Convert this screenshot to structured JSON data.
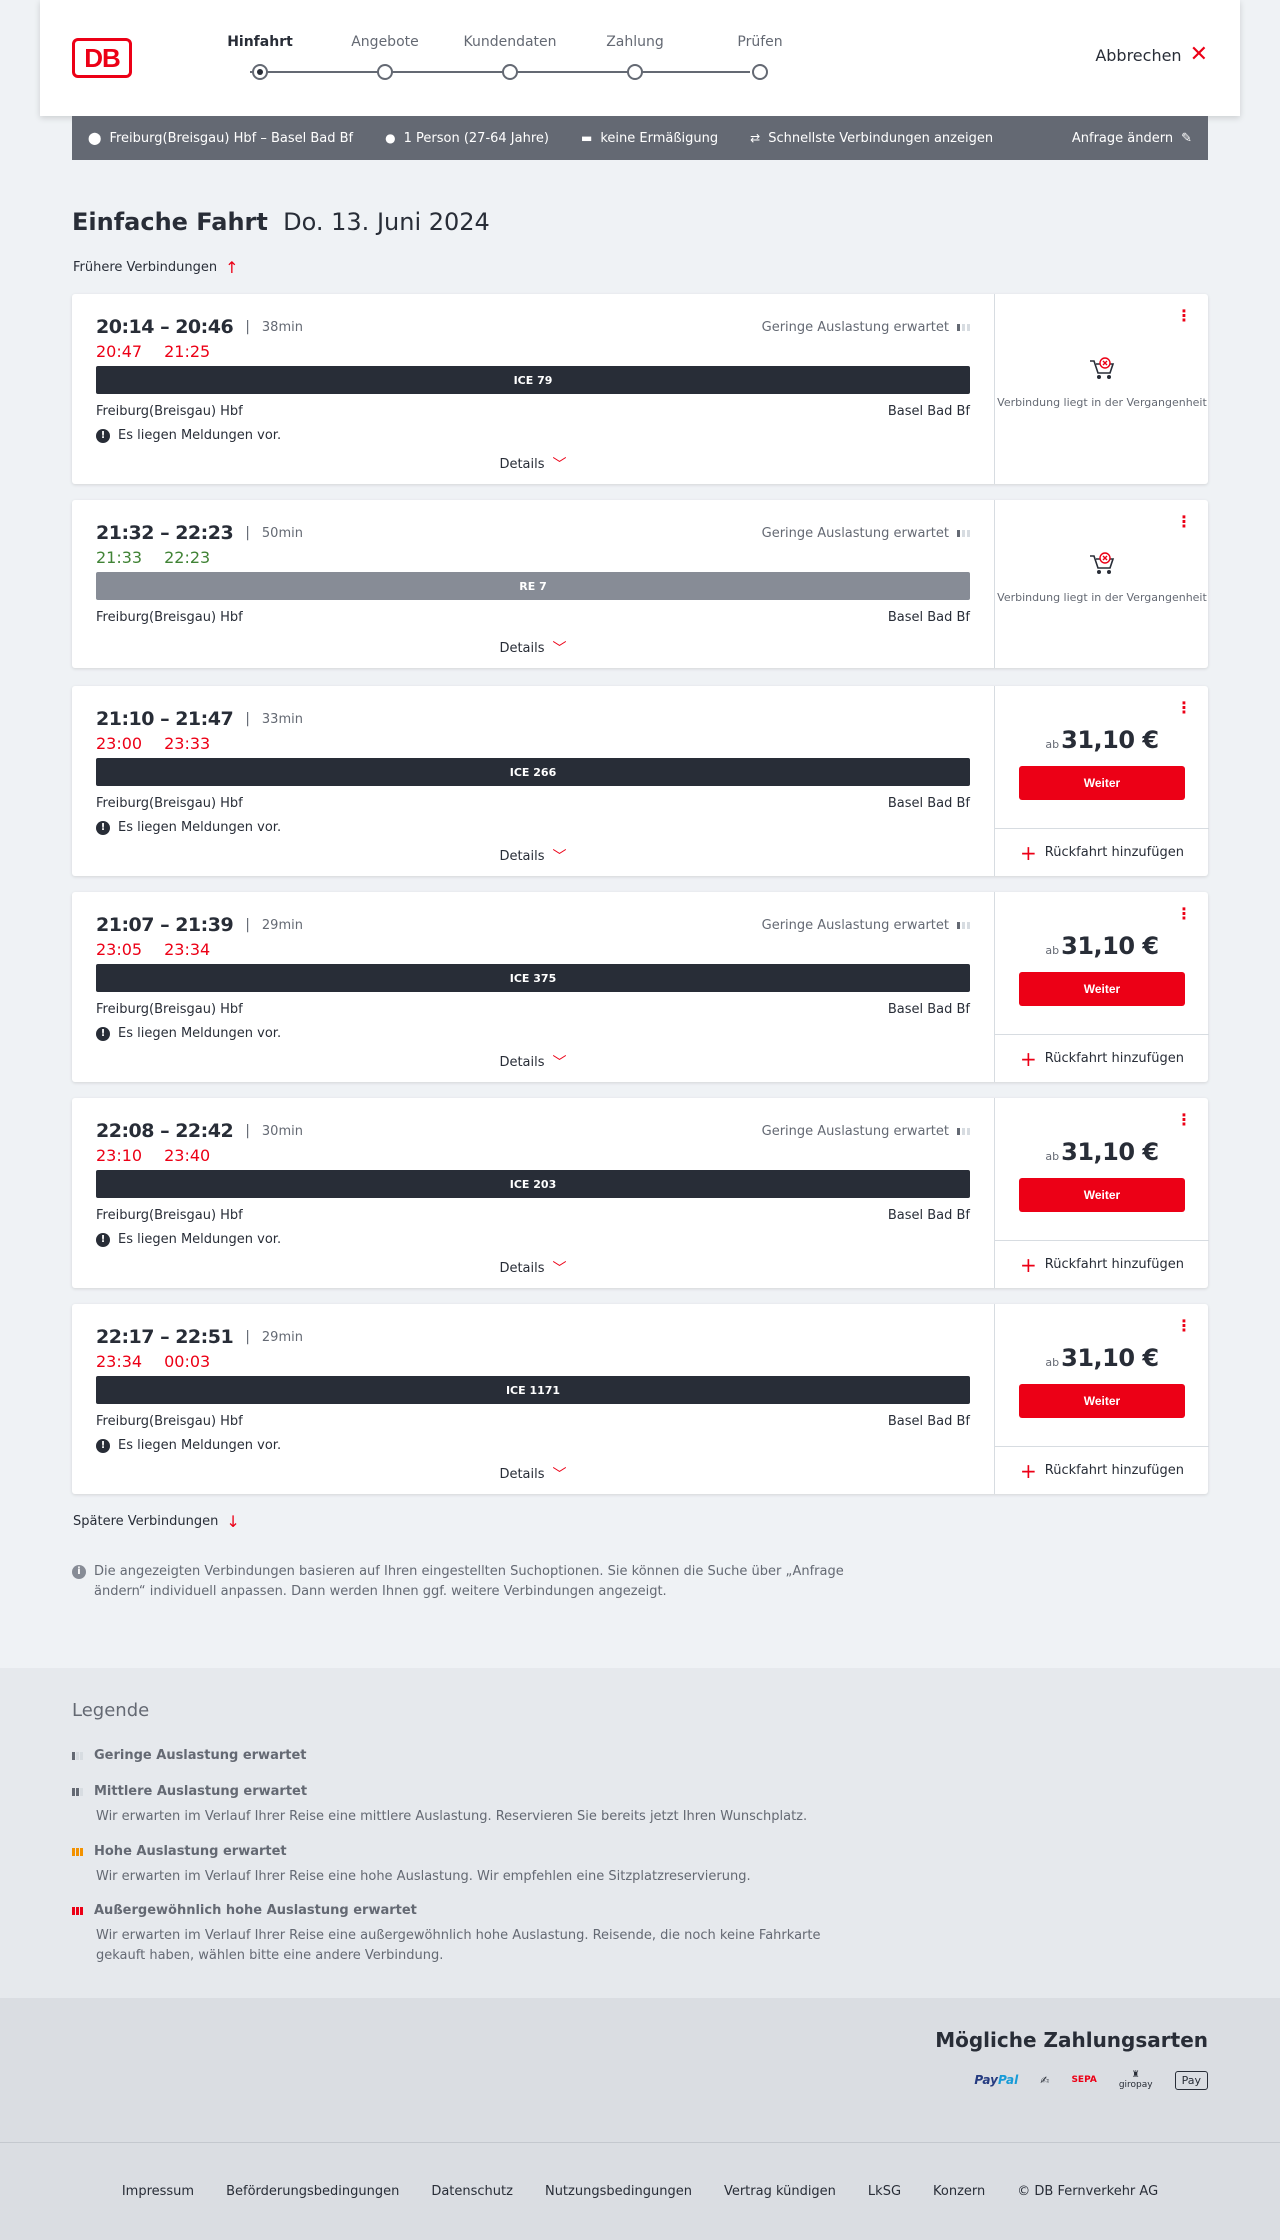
{
  "header": {
    "logo": "DB",
    "steps": [
      "Hinfahrt",
      "Angebote",
      "Kundendaten",
      "Zahlung",
      "Prüfen"
    ],
    "cancel_label": "Abbrechen"
  },
  "query": {
    "route": "Freiburg(Breisgau) Hbf – Basel Bad Bf",
    "persons": "1 Person (27-64 Jahre)",
    "discount": "keine Ermäßigung",
    "fastest": "Schnellste Verbindungen anzeigen",
    "edit_label": "Anfrage ändern"
  },
  "title": {
    "trip_type": "Einfache Fahrt",
    "date": "Do. 13. Juni 2024"
  },
  "earlier_label": "Frühere Verbindungen",
  "later_label": "Spätere Verbindungen",
  "common": {
    "details_label": "Details",
    "message_label": "Es liegen Meldungen vor.",
    "past_label": "Verbindung liegt in der Vergangenheit",
    "price_prefix": "ab",
    "weiter_label": "Weiter",
    "return_label": "Rückfahrt hinzufügen",
    "load_low": "Geringe Auslastung erwartet"
  },
  "connections": [
    {
      "times": "20:14 – 20:46",
      "duration": "38min",
      "rt_dep": "20:47",
      "rt_arr": "21:25",
      "rt_status": "late",
      "load": "Geringe Auslastung erwartet",
      "train": "ICE 79",
      "from": "Freiburg(Breisgau) Hbf",
      "to": "Basel Bad Bf",
      "message": true,
      "past": true
    },
    {
      "times": "21:32 – 22:23",
      "duration": "50min",
      "rt_dep": "21:33",
      "rt_arr": "22:23",
      "rt_status": "ok",
      "load": "Geringe Auslastung erwartet",
      "train": "RE 7",
      "from": "Freiburg(Breisgau) Hbf",
      "to": "Basel Bad Bf",
      "message": false,
      "past": true
    },
    {
      "times": "21:10 – 21:47",
      "duration": "33min",
      "rt_dep": "23:00",
      "rt_arr": "23:33",
      "rt_status": "late",
      "load": "",
      "train": "ICE 266",
      "from": "Freiburg(Breisgau) Hbf",
      "to": "Basel Bad Bf",
      "message": true,
      "past": false,
      "price": "31,10 €"
    },
    {
      "times": "21:07 – 21:39",
      "duration": "29min",
      "rt_dep": "23:05",
      "rt_arr": "23:34",
      "rt_status": "late",
      "load": "Geringe Auslastung erwartet",
      "train": "ICE 375",
      "from": "Freiburg(Breisgau) Hbf",
      "to": "Basel Bad Bf",
      "message": true,
      "past": false,
      "price": "31,10 €"
    },
    {
      "times": "22:08 – 22:42",
      "duration": "30min",
      "rt_dep": "23:10",
      "rt_arr": "23:40",
      "rt_status": "late",
      "load": "Geringe Auslastung erwartet",
      "train": "ICE 203",
      "from": "Freiburg(Breisgau) Hbf",
      "to": "Basel Bad Bf",
      "message": true,
      "past": false,
      "price": "31,10 €"
    },
    {
      "times": "22:17 – 22:51",
      "duration": "29min",
      "rt_dep": "23:34",
      "rt_arr": "00:03",
      "rt_status": "late",
      "load": "",
      "train": "ICE 1171",
      "from": "Freiburg(Breisgau) Hbf",
      "to": "Basel Bad Bf",
      "message": true,
      "past": false,
      "price": "31,10 €"
    }
  ],
  "info_text": "Die angezeigten Verbindungen basieren auf Ihren eingestellten Suchoptionen. Sie können die Suche über „Anfrage ändern“ individuell anpassen. Dann werden Ihnen ggf. weitere Verbindungen angezeigt.",
  "legend": {
    "title": "Legende",
    "items": [
      {
        "head": "Geringe Auslastung erwartet",
        "text": ""
      },
      {
        "head": "Mittlere Auslastung erwartet",
        "text": "Wir erwarten im Verlauf Ihrer Reise eine mittlere Auslastung. Reservieren Sie bereits jetzt Ihren Wunschplatz."
      },
      {
        "head": "Hohe Auslastung erwartet",
        "text": "Wir erwarten im Verlauf Ihrer Reise eine hohe Auslastung. Wir empfehlen eine Sitzplatzreservierung."
      },
      {
        "head": "Außergewöhnlich hohe Auslastung erwartet",
        "text": "Wir erwarten im Verlauf Ihrer Reise eine außergewöhnlich hohe Auslastung. Reisende, die noch keine Fahrkarte gekauft haben, wählen bitte eine andere Verbindung."
      }
    ]
  },
  "payment": {
    "title": "Mögliche Zahlungsarten",
    "methods": [
      "PayPal",
      "Kreditkarte",
      "SEPA",
      "giropay",
      "Apple Pay"
    ],
    "paypal_a": "Pay",
    "paypal_b": "Pal",
    "sepa": "SEPA",
    "giropay": "giropay",
    "applepay": " Pay"
  },
  "footer": {
    "links": [
      "Impressum",
      "Beförderungsbedingungen",
      "Datenschutz",
      "Nutzungsbedingungen",
      "Vertrag kündigen",
      "LkSG",
      "Konzern",
      "© DB Fernverkehr AG"
    ]
  },
  "colors": {
    "brand": "#ec0016",
    "dark": "#282d37",
    "ok": "#408335",
    "bg": "#eff2f5"
  }
}
